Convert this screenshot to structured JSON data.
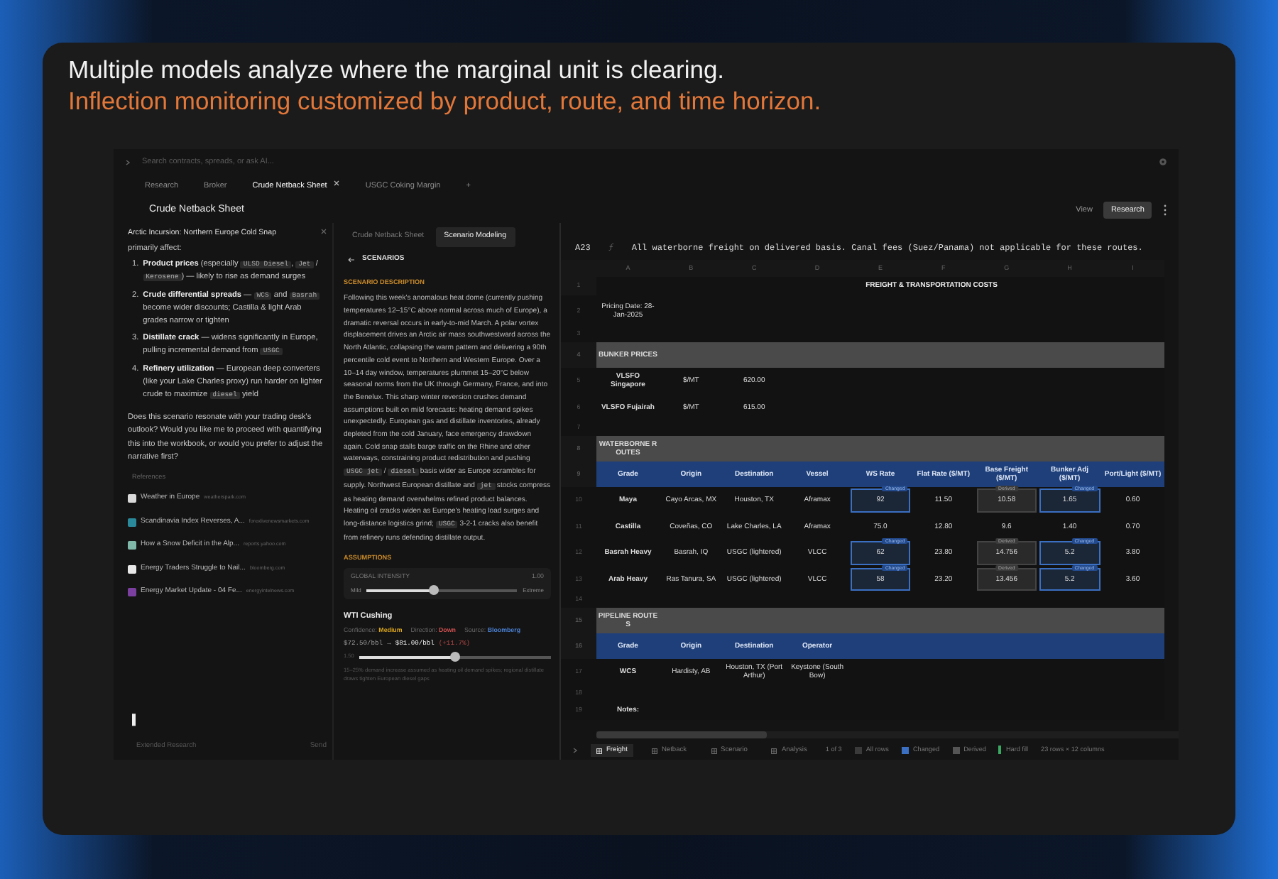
{
  "headline": {
    "line_1": "Multiple models analyze where the marginal unit is clearing.",
    "line_2": "Inflection monitoring customized by product, route, and time horizon."
  },
  "app": {
    "search": {
      "placeholder": "Search contracts, spreads, or ask AI..."
    },
    "tabs": [
      {
        "label": "Research",
        "selected": false,
        "closable": false
      },
      {
        "label": "Broker",
        "selected": false,
        "closable": false
      },
      {
        "label": "Crude Netback Sheet",
        "selected": true,
        "closable": true
      },
      {
        "label": "USGC Coking Margin",
        "selected": false,
        "closable": false
      }
    ],
    "add_tab": "+",
    "title": "Crude Netback Sheet",
    "view_label": "View",
    "mode_button": "Research",
    "chat": {
      "title": "Arctic Incursion: Northern Europe Cold Snap",
      "intro": "primarily affect:",
      "items": [
        {
          "marker": "1.",
          "segments": [
            {
              "kind": "bold",
              "text": "Product prices"
            },
            {
              "kind": "text",
              "text": " (especially "
            },
            {
              "kind": "code",
              "text": "ULSD Diesel"
            },
            {
              "kind": "text",
              "text": ", "
            },
            {
              "kind": "code",
              "text": "Jet"
            },
            {
              "kind": "text",
              "text": " / "
            },
            {
              "kind": "code",
              "text": "Kerosene"
            },
            {
              "kind": "text",
              "text": ") — likely to rise as demand surges"
            }
          ]
        },
        {
          "marker": "2.",
          "segments": [
            {
              "kind": "bold",
              "text": "Crude differential spreads"
            },
            {
              "kind": "text",
              "text": " — "
            },
            {
              "kind": "code",
              "text": "WCS"
            },
            {
              "kind": "text",
              "text": " and "
            },
            {
              "kind": "code",
              "text": "Basrah"
            },
            {
              "kind": "text",
              "text": " become wider discounts; Castilla & light Arab grades narrow or tighten"
            }
          ]
        },
        {
          "marker": "3.",
          "segments": [
            {
              "kind": "bold",
              "text": "Distillate crack"
            },
            {
              "kind": "text",
              "text": " — widens significantly in Europe, pulling incremental demand from "
            },
            {
              "kind": "code",
              "text": "USGC"
            }
          ]
        },
        {
          "marker": "4.",
          "segments": [
            {
              "kind": "bold",
              "text": "Refinery utilization"
            },
            {
              "kind": "text",
              "text": " — European deep converters (like your Lake Charles proxy) run harder on lighter crude to maximize "
            },
            {
              "kind": "code",
              "text": "diesel"
            },
            {
              "kind": "text",
              "text": " yield"
            }
          ]
        }
      ],
      "question": "Does this scenario resonate with your trading desk's outlook? Would you like me to proceed with quantifying this into the workbook, or would you prefer to adjust the narrative first?",
      "references_label": "References",
      "references": [
        {
          "title": "Weather in Europe",
          "domain": "weatherspark.com",
          "color": "#d9d9d9"
        },
        {
          "title": "Scandinavia Index Reverses, A...",
          "domain": "forexlivenewsmarkets.com",
          "color": "#2a8a9c"
        },
        {
          "title": "How a Snow Deficit in the Alp...",
          "domain": "reports.yahoo.com",
          "color": "#7fb8a8"
        },
        {
          "title": "Energy Traders Struggle to Nail...",
          "domain": "bloomberg.com",
          "color": "#e8e8e8"
        },
        {
          "title": "Energy Market Update - 04 Fe...",
          "domain": "energyintelnews.com",
          "color": "#7b3fa0"
        }
      ],
      "cursor": "▌",
      "mode_select": "Extended Research",
      "send": "Send"
    },
    "scenario": {
      "tabs": [
        {
          "label": "Crude Netback Sheet",
          "selected": false
        },
        {
          "label": "Scenario Modeling",
          "selected": true
        }
      ],
      "back_label": "SCENARIOS",
      "description_heading": "SCENARIO DESCRIPTION",
      "description": [
        {
          "kind": "text",
          "text": "Following this week's anomalous heat dome (currently pushing temperatures 12–15°C above normal across much of Europe), a dramatic reversal occurs in early-to-mid March. A polar vortex displacement drives an Arctic air mass southwestward across the North Atlantic, collapsing the warm pattern and delivering a 90th percentile cold event to Northern and Western Europe. Over a 10–14 day window, temperatures plummet 15–20°C below seasonal norms from the UK through Germany, France, and into the Benelux. This sharp winter reversion crushes demand assumptions built on mild forecasts: heating demand spikes unexpectedly. European gas and distillate inventories, already depleted from the cold January, face emergency drawdown again. Cold snap stalls barge traffic on the Rhine and other waterways, constraining product redistribution and pushing "
        },
        {
          "kind": "code",
          "text": "USGC jet"
        },
        {
          "kind": "text",
          "text": " / "
        },
        {
          "kind": "code",
          "text": "diesel"
        },
        {
          "kind": "text",
          "text": " basis wider as Europe scrambles for supply. Northwest European distillate and "
        },
        {
          "kind": "code",
          "text": "jet"
        },
        {
          "kind": "text",
          "text": " stocks compress as heating demand overwhelms refined product balances. Heating oil cracks widen as Europe's heating load surges and long-distance logistics grind; "
        },
        {
          "kind": "code",
          "text": "USGC"
        },
        {
          "kind": "text",
          "text": " 3-2-1 cracks also benefit from refinery runs defending distillate output."
        }
      ],
      "assumptions_heading": "ASSUMPTIONS",
      "intensity": {
        "label": "GLOBAL INTENSITY",
        "reading": "1.00",
        "min_label": "Mild",
        "max_label": "Extreme",
        "level": 0.45
      },
      "driver": {
        "name": "WTI Cushing",
        "meta": [
          {
            "label": "Confidence:",
            "value": "Medium",
            "color": "#d9a520"
          },
          {
            "label": "Direction:",
            "value": "Down",
            "color": "#d05050"
          },
          {
            "label": "Source:",
            "value": "Bloomberg",
            "color": "#4a7fd0"
          }
        ],
        "from": "$72.50/bbl",
        "arrow": "→",
        "to": "$81.00/bbl",
        "change": "(+11.7%)",
        "slider_label": "1.50",
        "level": 0.5,
        "note": "15–25% demand increase assumed as heating oil demand spikes; regional distillate draws tighten European diesel gaps"
      }
    },
    "sheet": {
      "cell_ref": "A23",
      "formula": "All waterborne freight on delivered basis. Canal fees (Suez/Panama) not applicable for these routes.",
      "columns": [
        "A",
        "B",
        "C",
        "D",
        "E",
        "F",
        "G",
        "H",
        "I"
      ],
      "rows": [
        {
          "number": "1",
          "kind": "title",
          "cells": [
            "",
            "",
            "",
            "",
            "FREIGHT & TRANSPORTATION COSTS"
          ]
        },
        {
          "number": "2",
          "kind": "date",
          "cells": [
            "Pricing Date: 28-Jan-2025"
          ]
        },
        {
          "number": "3",
          "kind": "blank",
          "cells": []
        },
        {
          "number": "4",
          "kind": "section",
          "cells": [
            "BUNKER PRICES"
          ]
        },
        {
          "number": "5",
          "kind": "data",
          "cells": [
            "VLSFO Singapore",
            "$/MT",
            "620.00"
          ]
        },
        {
          "number": "6",
          "kind": "data",
          "cells": [
            "VLSFO Fujairah",
            "$/MT",
            "615.00"
          ]
        },
        {
          "number": "7",
          "kind": "blank",
          "cells": []
        },
        {
          "number": "8",
          "kind": "section",
          "cells": [
            "WATERBORNE ROUTES"
          ]
        },
        {
          "number": "9",
          "kind": "header",
          "cells": [
            "Grade",
            "Origin",
            "Destination",
            "Vessel",
            "WS Rate",
            "Flat Rate ($/MT)",
            "Base Freight ($/MT)",
            "Bunker Adj ($/MT)",
            "Port/Light ($/MT)"
          ]
        },
        {
          "number": "10",
          "kind": "data",
          "cells": [
            "Maya",
            "Cayo Arcas, MX",
            "Houston, TX",
            "Aframax",
            {
              "text": "92",
              "kind": "changed",
              "tag": "Changed"
            },
            "11.50",
            {
              "text": "10.58",
              "kind": "derived",
              "tag": "Derived"
            },
            {
              "text": "1.65",
              "kind": "changed",
              "tag": "Changed"
            },
            "0.60"
          ]
        },
        {
          "number": "11",
          "kind": "data",
          "cells": [
            "Castilla",
            "Coveñas, CO",
            "Lake Charles, LA",
            "Aframax",
            "75.0",
            "12.80",
            "9.6",
            "1.40",
            "0.70"
          ]
        },
        {
          "number": "12",
          "kind": "data",
          "cells": [
            "Basrah Heavy",
            "Basrah, IQ",
            "USGC (lightered)",
            "VLCC",
            {
              "text": "62",
              "kind": "changed",
              "tag": "Changed"
            },
            "23.80",
            {
              "text": "14.756",
              "kind": "derived",
              "tag": "Derived"
            },
            {
              "text": "5.2",
              "kind": "changed",
              "tag": "Changed"
            },
            "3.80"
          ]
        },
        {
          "number": "13",
          "kind": "data",
          "cells": [
            "Arab Heavy",
            "Ras Tanura, SA",
            "USGC (lightered)",
            "VLCC",
            {
              "text": "58",
              "kind": "changed",
              "tag": "Changed"
            },
            "23.20",
            {
              "text": "13.456",
              "kind": "derived",
              "tag": "Derived"
            },
            {
              "text": "5.2",
              "kind": "changed",
              "tag": "Changed"
            },
            "3.60"
          ]
        },
        {
          "number": "14",
          "kind": "blank",
          "cells": []
        },
        {
          "number": "15",
          "kind": "section",
          "cells": [
            "PIPELINE ROUTES"
          ]
        },
        {
          "number": "16",
          "kind": "header",
          "cells": [
            "Grade",
            "Origin",
            "Destination",
            "Operator"
          ]
        },
        {
          "number": "17",
          "kind": "data",
          "cells": [
            "WCS",
            "Hardisty, AB",
            "Houston, TX (Port Arthur)",
            "Keystone (South Bow)"
          ]
        },
        {
          "number": "18",
          "kind": "blank",
          "cells": []
        },
        {
          "number": "19",
          "kind": "notes",
          "cells": [
            "Notes:"
          ]
        }
      ],
      "sheet_tabs": [
        {
          "label": "Freight",
          "selected": true
        },
        {
          "label": "Netback",
          "selected": false
        },
        {
          "label": "Scenario",
          "selected": false
        },
        {
          "label": "Analysis",
          "selected": false
        }
      ],
      "status": [
        {
          "kind": "text",
          "text": "1 of 3"
        },
        {
          "kind": "legend",
          "text": "All rows",
          "color": "#3a3a3a"
        },
        {
          "kind": "legend",
          "text": "Changed",
          "color": "#3b6fc2"
        },
        {
          "kind": "legend",
          "text": "Derived",
          "color": "#555555"
        },
        {
          "kind": "bar",
          "text": "Hard fill",
          "color": "#3aa860"
        },
        {
          "kind": "text",
          "text": "23 rows × 12 columns"
        }
      ]
    }
  }
}
